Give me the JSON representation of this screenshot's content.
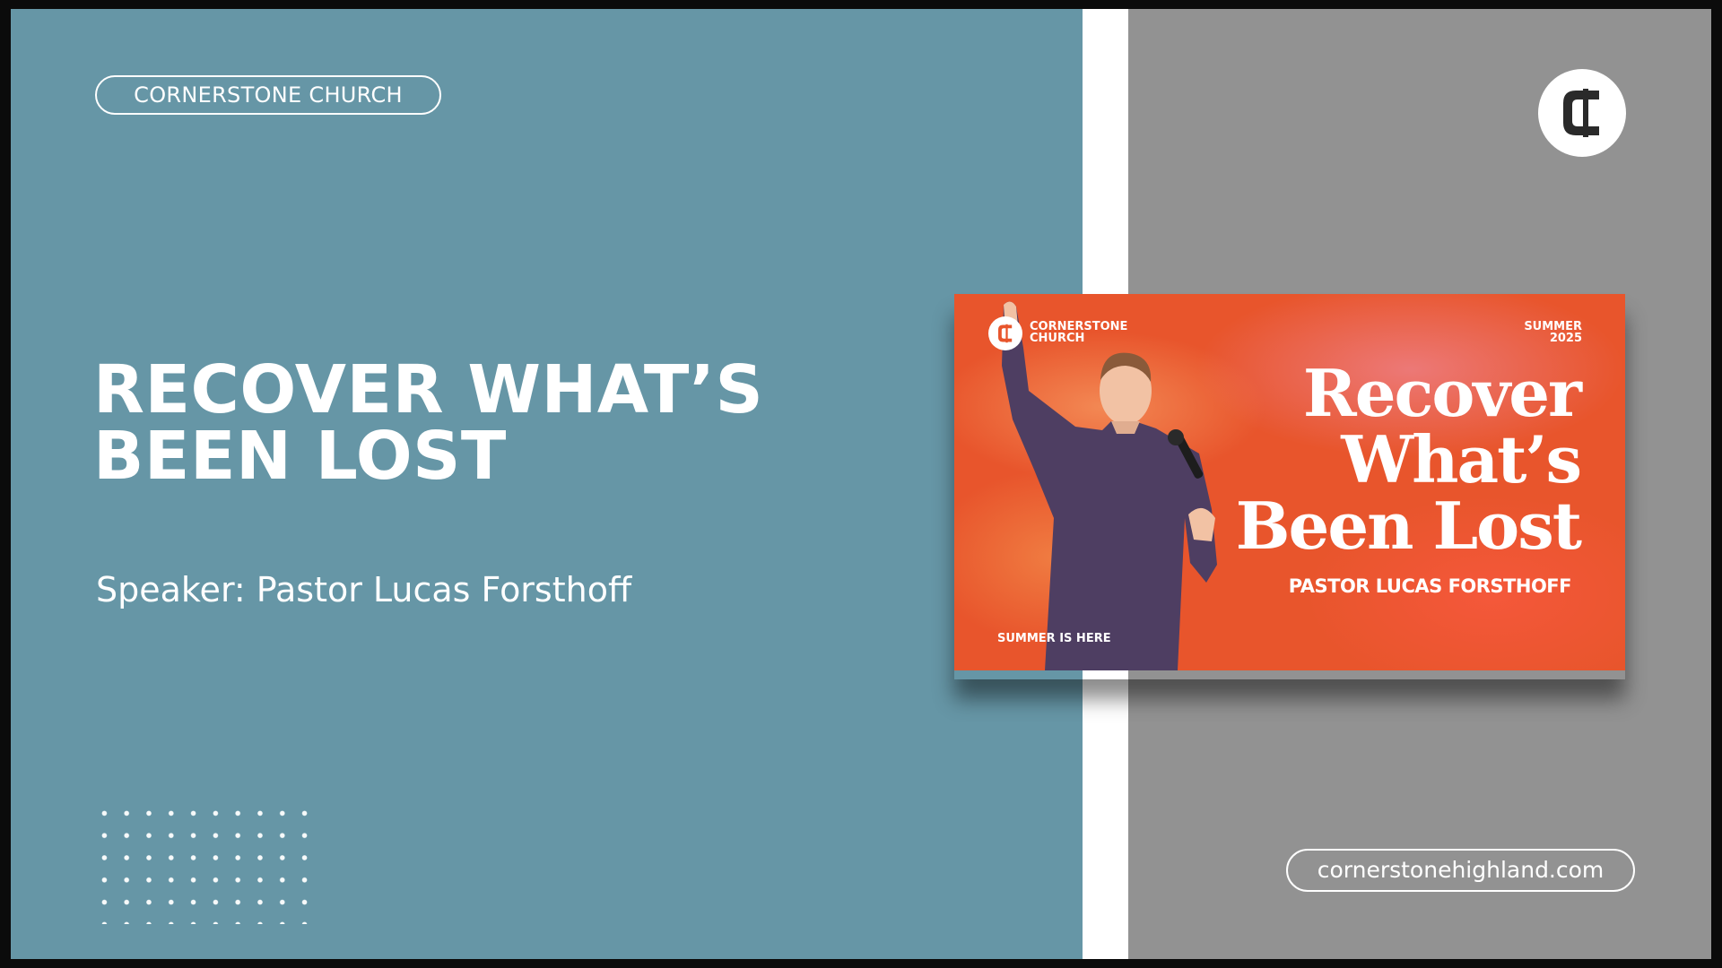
{
  "slide": {
    "church_name": "CORNERSTONE CHURCH",
    "title": "RECOVER WHAT’S BEEN LOST",
    "speaker": "Speaker: Pastor Lucas Forsthoff",
    "website": "cornerstonehighland.com",
    "logo_icon": "cornerstone-c-logo-icon"
  },
  "thumbnail": {
    "church_name": "CORNERSTONE CHURCH",
    "season": "SUMMER 2025",
    "title": "Recover What’s Been Lost",
    "speaker": "PASTOR LUCAS FORSTHOFF",
    "tagline": "SUMMER IS HERE"
  },
  "colors": {
    "left_panel": "#6696a6",
    "right_panel": "#929292",
    "stripe": "#ffffff",
    "thumbnail_accent": "#e8552c",
    "text": "#ffffff"
  }
}
